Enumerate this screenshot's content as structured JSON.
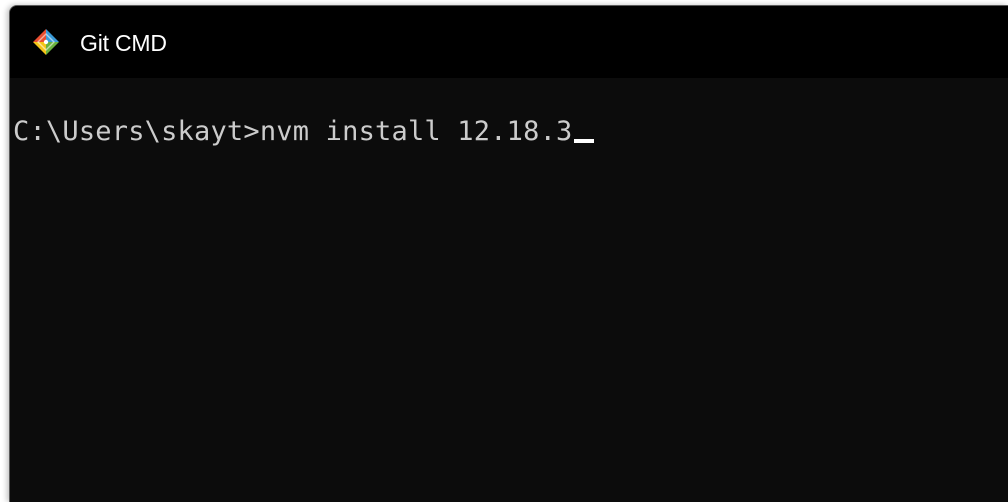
{
  "window": {
    "title": "Git CMD",
    "app_icon": "git-logo-icon"
  },
  "console": {
    "prompt": "C:\\Users\\skayt>",
    "command": "nvm install 12.18.3",
    "cursor": "underscore-cursor"
  },
  "colors": {
    "titlebar_bg": "#000000",
    "console_bg": "#0c0c0c",
    "text": "#cccccc",
    "title_text": "#ffffff"
  }
}
